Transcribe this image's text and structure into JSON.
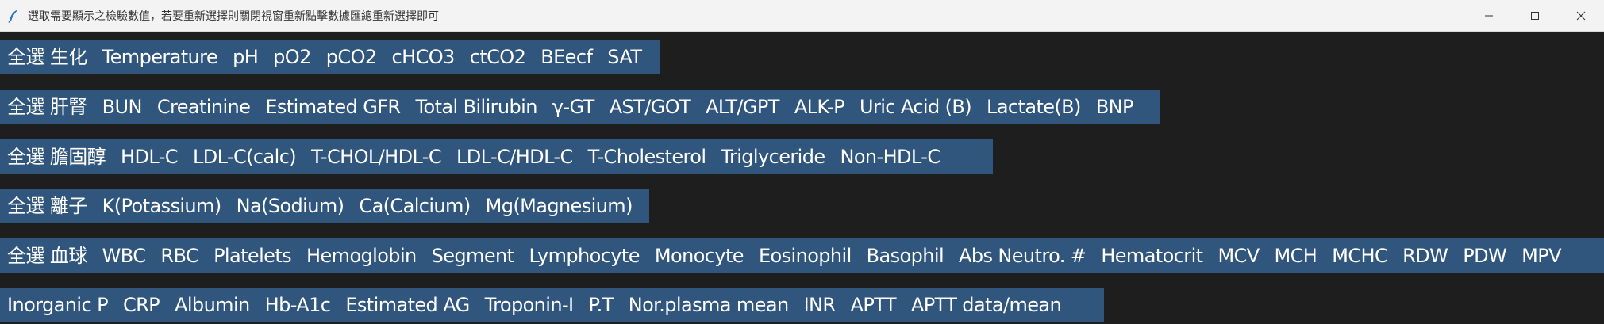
{
  "window": {
    "title": "選取需要顯示之檢驗數值，若要重新選擇則關閉視窗重新點擊數據匯總重新選擇即可",
    "icon": "feather-icon",
    "controls": [
      "minimize-icon",
      "maximize-icon",
      "close-icon"
    ]
  },
  "rows": [
    {
      "select_all": "全選 生化",
      "items": [
        "Temperature",
        "pH",
        "pO2",
        "pCO2",
        "cHCO3",
        "ctCO2",
        "BEecf",
        "SAT"
      ]
    },
    {
      "select_all": "全選 肝腎",
      "items": [
        "BUN",
        "Creatinine",
        "Estimated GFR",
        "Total Bilirubin",
        "γ-GT",
        "AST/GOT",
        "ALT/GPT",
        "ALK-P",
        "Uric Acid (B)",
        "Lactate(B)",
        "BNP"
      ]
    },
    {
      "select_all": "全選 膽固醇",
      "items": [
        "HDL-C",
        "LDL-C(calc)",
        "T-CHOL/HDL-C",
        "LDL-C/HDL-C",
        "T-Cholesterol",
        "Triglyceride",
        "Non-HDL-C"
      ]
    },
    {
      "select_all": "全選 離子",
      "items": [
        "K(Potassium)",
        "Na(Sodium)",
        "Ca(Calcium)",
        "Mg(Magnesium)"
      ]
    },
    {
      "select_all": "全選 血球",
      "items": [
        "WBC",
        "RBC",
        "Platelets",
        "Hemoglobin",
        "Segment",
        "Lymphocyte",
        "Monocyte",
        "Eosinophil",
        "Basophil",
        "Abs Neutro. #",
        "Hematocrit",
        "MCV",
        "MCH",
        "MCHC",
        "RDW",
        "PDW",
        "MPV"
      ]
    },
    {
      "select_all": "",
      "items": [
        "Inorganic P",
        "CRP",
        "Albumin",
        "Hb-A1c",
        "Estimated AG",
        "Troponin-I",
        "P.T",
        "Nor.plasma mean",
        "INR",
        "APTT",
        "APTT data/mean"
      ]
    }
  ],
  "colors": {
    "background": "#1e1e1e",
    "row_background": "#30567d",
    "text": "#ffffff",
    "titlebar": "#f3f3f3"
  }
}
